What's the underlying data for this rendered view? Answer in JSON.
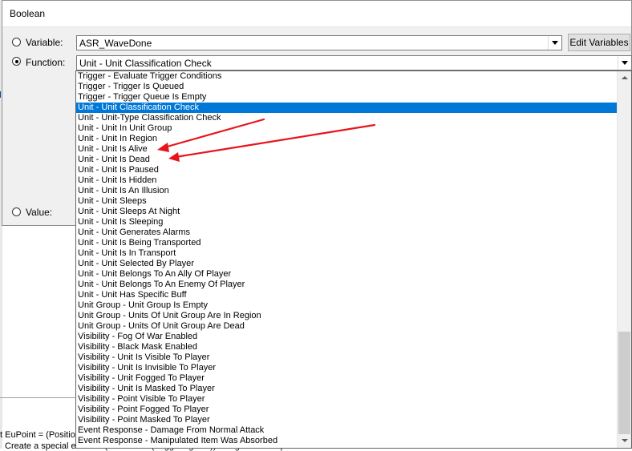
{
  "background": {
    "line1": "t EuPoint = (Position",
    "line2": "Create a special effect at (Position of (Triggering unit)) using Abilities\\Spells\\..."
  },
  "dialog": {
    "title": "Boolean",
    "variable": {
      "label": "Variable:",
      "value": "ASR_WaveDone"
    },
    "edit_button": "Edit Variables",
    "function": {
      "label": "Function:",
      "value": "Unit - Unit Classification Check"
    },
    "value_label": "Value:"
  },
  "dropdown": {
    "selected_index": 3,
    "items": [
      "Trigger - Evaluate Trigger Conditions",
      "Trigger - Trigger Is Queued",
      "Trigger - Trigger Queue Is Empty",
      "Unit - Unit Classification Check",
      "Unit - Unit-Type Classification Check",
      "Unit - Unit In Unit Group",
      "Unit - Unit In Region",
      "Unit - Unit Is Alive",
      "Unit - Unit Is Dead",
      "Unit - Unit Is Paused",
      "Unit - Unit Is Hidden",
      "Unit - Unit Is An Illusion",
      "Unit - Unit Sleeps",
      "Unit - Unit Sleeps At Night",
      "Unit - Unit Is Sleeping",
      "Unit - Unit Generates Alarms",
      "Unit - Unit Is Being Transported",
      "Unit - Unit Is In Transport",
      "Unit - Unit Selected By Player",
      "Unit - Unit Belongs To An Ally Of Player",
      "Unit - Unit Belongs To An Enemy Of Player",
      "Unit - Unit Has Specific Buff",
      "Unit Group - Unit Group Is Empty",
      "Unit Group - Units Of Unit Group Are In Region",
      "Unit Group - Units Of Unit Group Are Dead",
      "Visibility - Fog Of War Enabled",
      "Visibility - Black Mask Enabled",
      "Visibility - Unit Is Visible To Player",
      "Visibility - Unit Is Invisible To Player",
      "Visibility - Unit Fogged To Player",
      "Visibility - Unit Is Masked To Player",
      "Visibility - Point Visible To Player",
      "Visibility - Point Fogged To Player",
      "Visibility - Point Masked To Player",
      "Event Response - Damage From Normal Attack",
      "Event Response - Manipulated Item Was Absorbed"
    ]
  },
  "colors": {
    "selection": "#0078d7",
    "annotation_arrow": "#e8141b"
  }
}
